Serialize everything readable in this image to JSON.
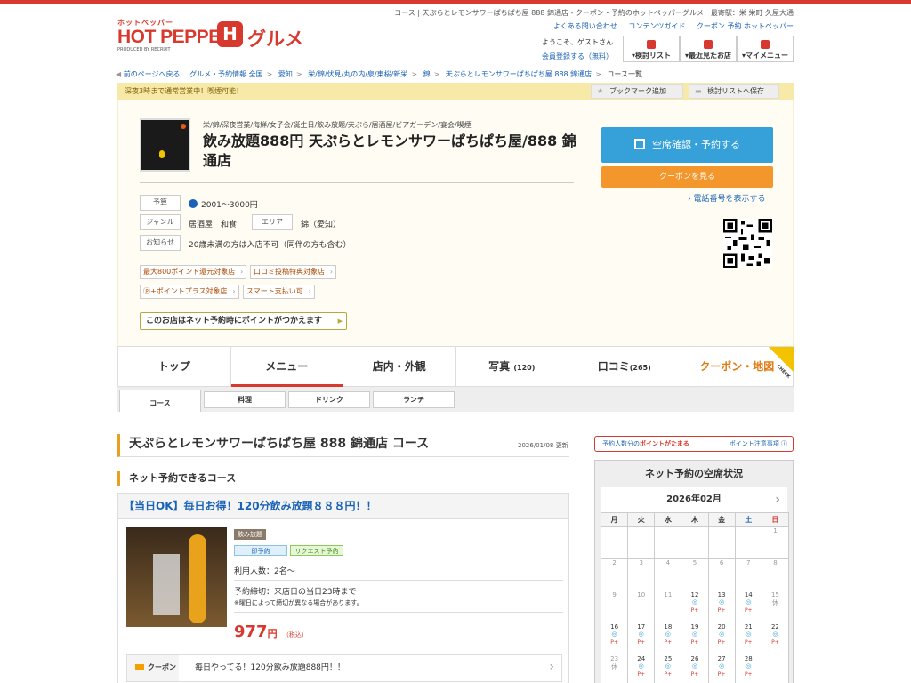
{
  "header": {
    "logo_small": "ホットペッパー",
    "logo_big": "HOT PEPPER",
    "logo_produced": "PRODUCED BY RECRUIT",
    "logo_h": "H",
    "logo_gurume": "グルメ",
    "top_text": "コース | 天ぷらとレモンサワーぱちぱち屋 888 錦通店 - クーポン・予約のホットペッパーグルメ　最寄駅：栄 栄町 久屋大通",
    "links": [
      "よくある問い合わせ",
      "コンテンツガイド",
      "クーポン 予約 ホットペッパー"
    ],
    "greeting": "ようこそ、ゲストさん",
    "register": "会員登録する（無料）",
    "buttons": [
      "▾検討リスト",
      "▾最近見たお店",
      "▾マイメニュー"
    ]
  },
  "breadcrumb": [
    "前のページへ戻る",
    "グルメ・予約情報 全国",
    "愛知",
    "栄/錦/伏見/丸の内/泉/東桜/新栄",
    "錦",
    "天ぷらとレモンサワーぱちぱち屋 888 錦通店",
    "コース一覧"
  ],
  "notice": {
    "text": "深夜3時まで通常営業中！喫煙可能！",
    "bookmark": "ブックマーク追加",
    "save": "検討リストへ保存"
  },
  "shop": {
    "genre": "栄/錦/深夜営業/海鮮/女子会/誕生日/飲み放題/天ぷら/居酒屋/ビアガーデン/宴会/喫煙",
    "name": "飲み放題888円 天ぷらとレモンサワーぱちぱち屋/888 錦通店",
    "budget_label": "予算",
    "budget": "2001～3000円",
    "genre_label": "ジャンル",
    "genre_value": "居酒屋　和食",
    "area_label": "エリア",
    "area_value": "錦（愛知）",
    "info_label": "お知らせ",
    "info_value": "20歳未満の方は入店不可（同伴の方も含む）",
    "tags": [
      "最大800ポイント還元対象店",
      "口コミ投稿特典対象店",
      "ⓟ+ポイントプラス対象店",
      "スマート支払い可"
    ],
    "point_bar": "このお店はネット予約時にポイントがつかえます",
    "reserve_btn": "空席確認・予約する",
    "coupon_btn": "クーポンを見る",
    "tel": "› 電話番号を表示する",
    "colors": {
      "accent": "#d8392f",
      "reserve": "#36a0d9",
      "coupon": "#f3962c"
    }
  },
  "tabs": [
    {
      "label": "トップ",
      "count": ""
    },
    {
      "label": "メニュー",
      "count": ""
    },
    {
      "label": "店内・外観",
      "count": ""
    },
    {
      "label": "写真",
      "count": "(120)"
    },
    {
      "label": "口コミ",
      "count": "(265)"
    },
    {
      "label": "クーポン・地図",
      "count": ""
    }
  ],
  "check_badge": "CHECK",
  "subtabs": [
    "コース",
    "料理",
    "ドリンク",
    "ランチ"
  ],
  "main": {
    "heading": "天ぷらとレモンサワーぱちぱち屋 888 錦通店 コース",
    "updated": "2026/01/08 更新",
    "section": "ネット予約できるコース",
    "course": {
      "title": "【当日OK】毎日お得！120分飲み放題８８８円！！",
      "badge_plan": "飲み放題",
      "badge_instant": "即予約",
      "badge_request": "リクエスト予約",
      "people": "利用人数：2名～",
      "deadline": "予約締切：来店日の当日23時まで",
      "note": "※曜日によって締切が異なる場合があります。",
      "price": "977",
      "price_unit": "円",
      "tax": "（税込）",
      "coupon_label": "クーポン",
      "coupon_text": "毎日やってる！120分飲み放題888円！！"
    }
  },
  "side": {
    "bar_pre": "予約人数分の",
    "bar_mid": "ポイントがたまる",
    "bar_link": "ポイント注意事項 ⓘ",
    "heading": "ネット予約の空席状況",
    "month": "2026年02月",
    "weekdays": [
      "月",
      "火",
      "水",
      "木",
      "金",
      "土",
      "日"
    ]
  }
}
